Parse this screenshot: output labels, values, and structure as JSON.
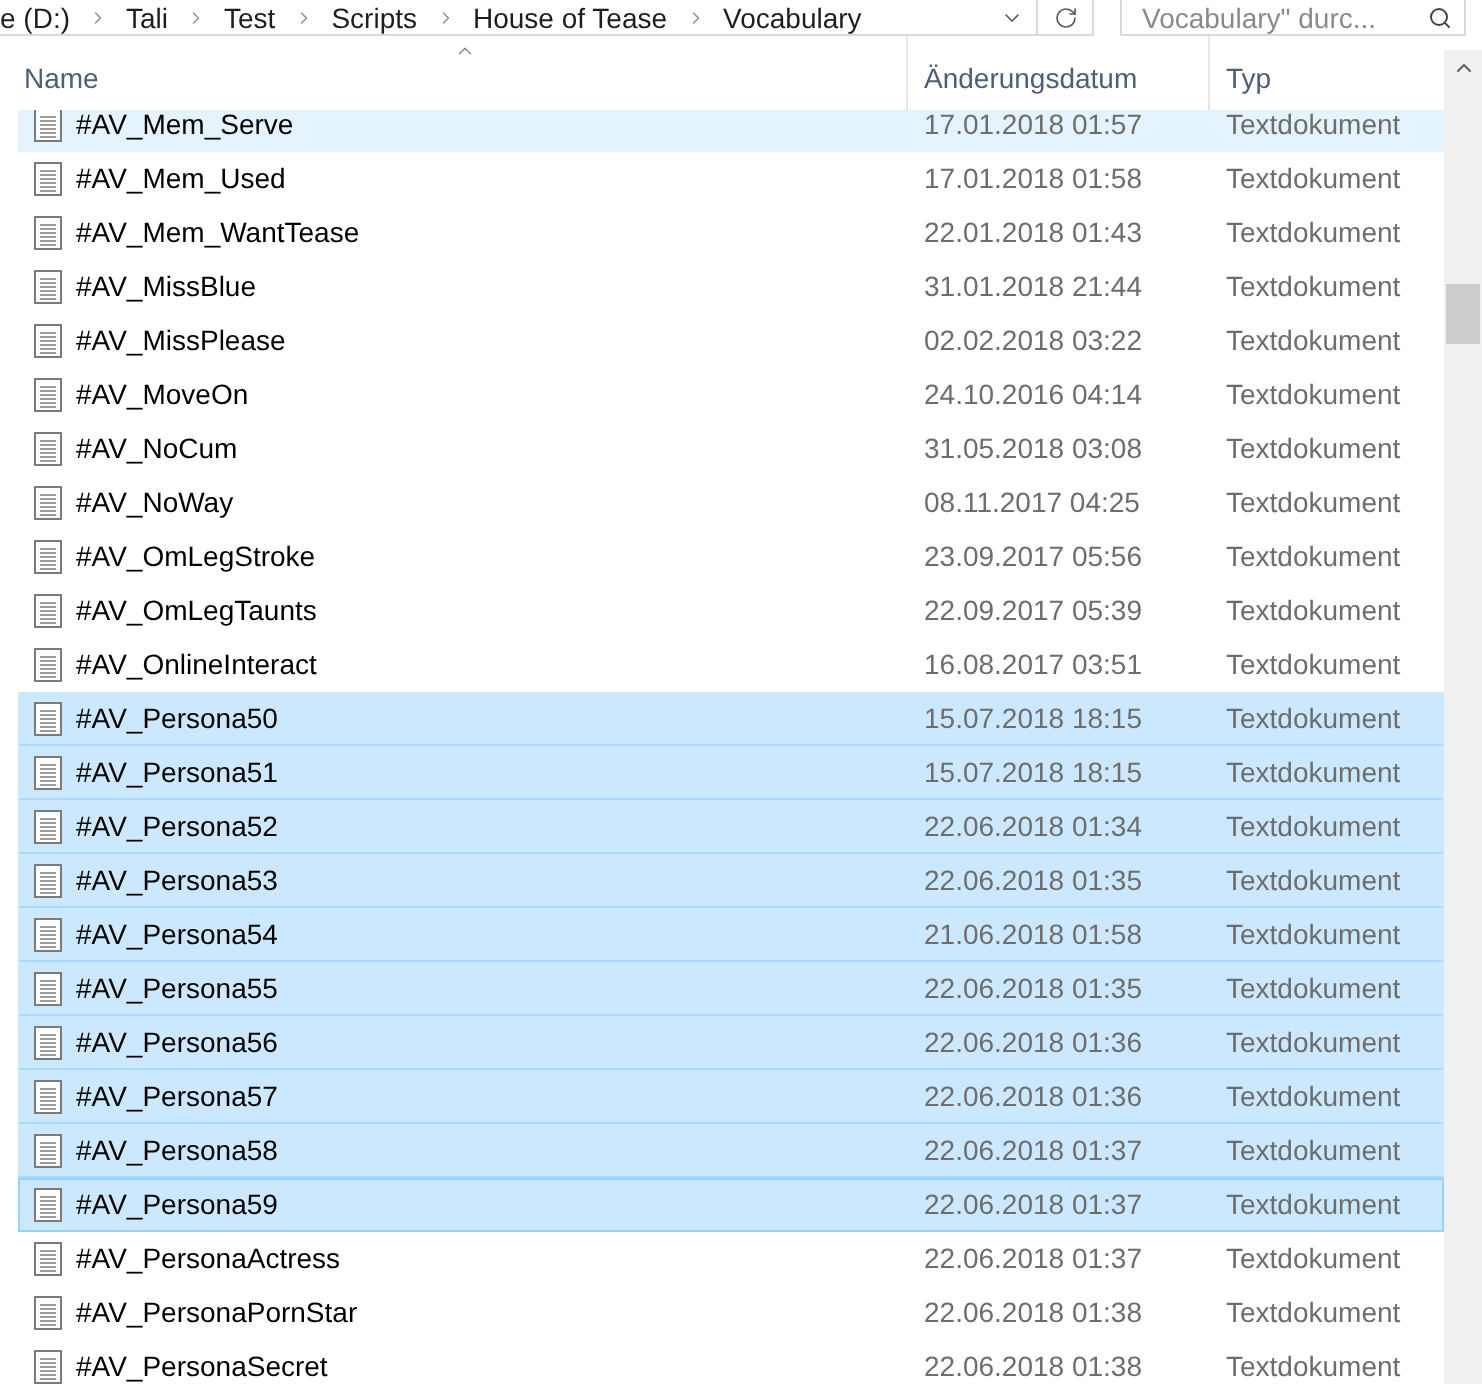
{
  "address_bar": {
    "path": [
      {
        "label": "e (D:)"
      },
      {
        "label": "Tali"
      },
      {
        "label": "Test"
      },
      {
        "label": "Scripts"
      },
      {
        "label": "House of Tease"
      },
      {
        "label": "Vocabulary"
      }
    ]
  },
  "search": {
    "placeholder": "Vocabulary\" durc..."
  },
  "columns": [
    {
      "label": "Name",
      "sorted": true
    },
    {
      "label": "Änderungsdatum",
      "sorted": false
    },
    {
      "label": "Typ",
      "sorted": false
    }
  ],
  "rows": [
    {
      "name": "#AV_Mem_Serve",
      "date": "17.01.2018 01:57",
      "type": "Textdokument",
      "selected": false,
      "hovered": true,
      "focused": false
    },
    {
      "name": "#AV_Mem_Used",
      "date": "17.01.2018 01:58",
      "type": "Textdokument",
      "selected": false,
      "hovered": false,
      "focused": false
    },
    {
      "name": "#AV_Mem_WantTease",
      "date": "22.01.2018 01:43",
      "type": "Textdokument",
      "selected": false,
      "hovered": false,
      "focused": false
    },
    {
      "name": "#AV_MissBlue",
      "date": "31.01.2018 21:44",
      "type": "Textdokument",
      "selected": false,
      "hovered": false,
      "focused": false
    },
    {
      "name": "#AV_MissPlease",
      "date": "02.02.2018 03:22",
      "type": "Textdokument",
      "selected": false,
      "hovered": false,
      "focused": false
    },
    {
      "name": "#AV_MoveOn",
      "date": "24.10.2016 04:14",
      "type": "Textdokument",
      "selected": false,
      "hovered": false,
      "focused": false
    },
    {
      "name": "#AV_NoCum",
      "date": "31.05.2018 03:08",
      "type": "Textdokument",
      "selected": false,
      "hovered": false,
      "focused": false
    },
    {
      "name": "#AV_NoWay",
      "date": "08.11.2017 04:25",
      "type": "Textdokument",
      "selected": false,
      "hovered": false,
      "focused": false
    },
    {
      "name": "#AV_OmLegStroke",
      "date": "23.09.2017 05:56",
      "type": "Textdokument",
      "selected": false,
      "hovered": false,
      "focused": false
    },
    {
      "name": "#AV_OmLegTaunts",
      "date": "22.09.2017 05:39",
      "type": "Textdokument",
      "selected": false,
      "hovered": false,
      "focused": false
    },
    {
      "name": "#AV_OnlineInteract",
      "date": "16.08.2017 03:51",
      "type": "Textdokument",
      "selected": false,
      "hovered": false,
      "focused": false
    },
    {
      "name": "#AV_Persona50",
      "date": "15.07.2018 18:15",
      "type": "Textdokument",
      "selected": true,
      "hovered": false,
      "focused": false
    },
    {
      "name": "#AV_Persona51",
      "date": "15.07.2018 18:15",
      "type": "Textdokument",
      "selected": true,
      "hovered": false,
      "focused": false
    },
    {
      "name": "#AV_Persona52",
      "date": "22.06.2018 01:34",
      "type": "Textdokument",
      "selected": true,
      "hovered": false,
      "focused": false
    },
    {
      "name": "#AV_Persona53",
      "date": "22.06.2018 01:35",
      "type": "Textdokument",
      "selected": true,
      "hovered": false,
      "focused": false
    },
    {
      "name": "#AV_Persona54",
      "date": "21.06.2018 01:58",
      "type": "Textdokument",
      "selected": true,
      "hovered": false,
      "focused": false
    },
    {
      "name": "#AV_Persona55",
      "date": "22.06.2018 01:35",
      "type": "Textdokument",
      "selected": true,
      "hovered": false,
      "focused": false
    },
    {
      "name": "#AV_Persona56",
      "date": "22.06.2018 01:36",
      "type": "Textdokument",
      "selected": true,
      "hovered": false,
      "focused": false
    },
    {
      "name": "#AV_Persona57",
      "date": "22.06.2018 01:36",
      "type": "Textdokument",
      "selected": true,
      "hovered": false,
      "focused": false
    },
    {
      "name": "#AV_Persona58",
      "date": "22.06.2018 01:37",
      "type": "Textdokument",
      "selected": true,
      "hovered": false,
      "focused": false
    },
    {
      "name": "#AV_Persona59",
      "date": "22.06.2018 01:37",
      "type": "Textdokument",
      "selected": true,
      "hovered": false,
      "focused": true
    },
    {
      "name": "#AV_PersonaActress",
      "date": "22.06.2018 01:37",
      "type": "Textdokument",
      "selected": false,
      "hovered": false,
      "focused": false
    },
    {
      "name": "#AV_PersonaPornStar",
      "date": "22.06.2018 01:38",
      "type": "Textdokument",
      "selected": false,
      "hovered": false,
      "focused": false
    },
    {
      "name": "#AV_PersonaSecret",
      "date": "22.06.2018 01:38",
      "type": "Textdokument",
      "selected": false,
      "hovered": false,
      "focused": false
    }
  ]
}
